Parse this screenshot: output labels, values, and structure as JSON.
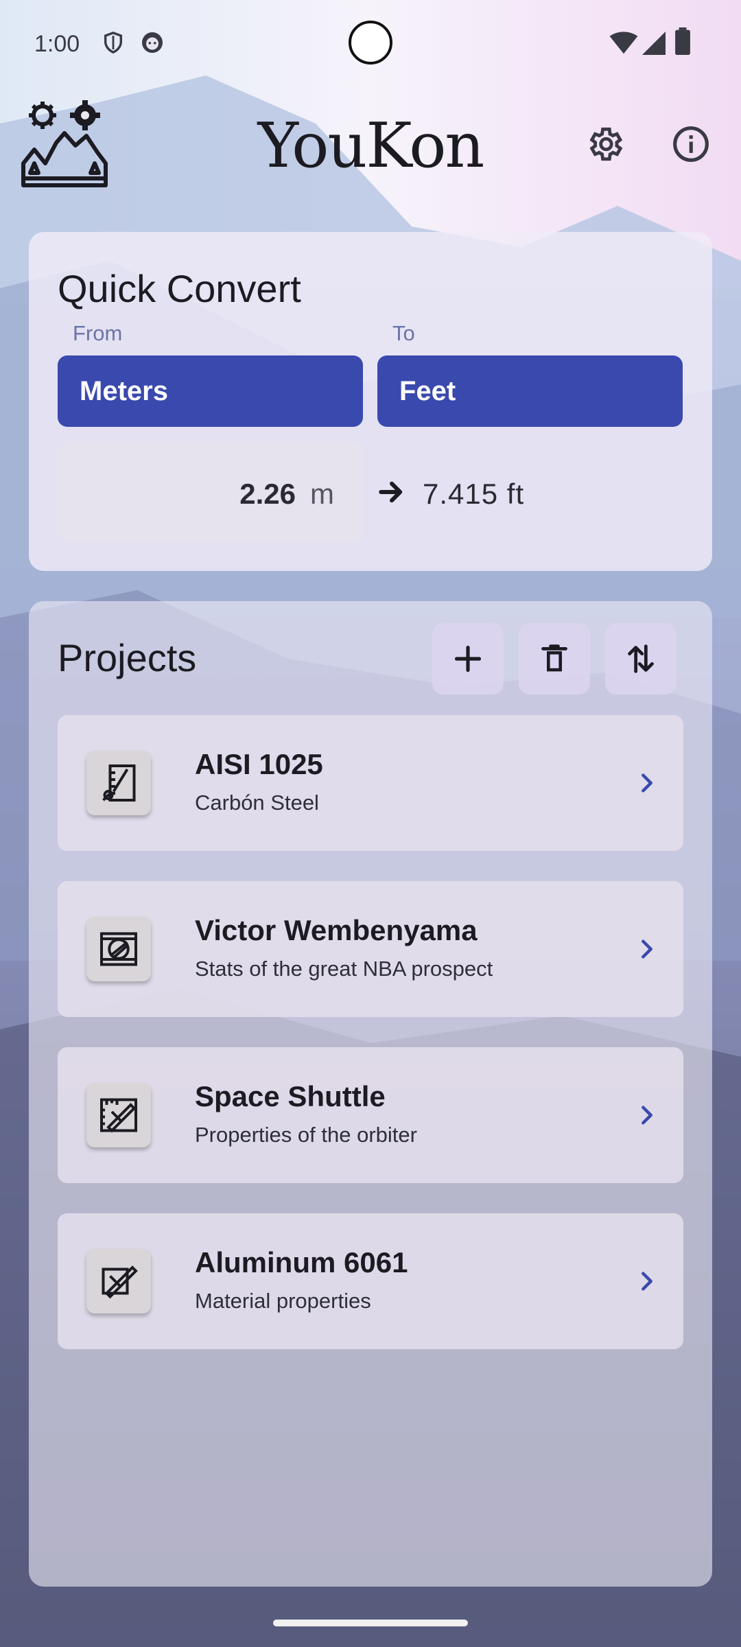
{
  "status_bar": {
    "time": "1:00",
    "icons_left": [
      "shield-icon",
      "face-icon"
    ],
    "icons_right": [
      "wifi-icon",
      "signal-icon",
      "battery-icon"
    ]
  },
  "header": {
    "title": "YouKon",
    "logo_icon": "mountain-gear-logo",
    "settings_icon": "gear-icon",
    "info_icon": "info-icon"
  },
  "quick_convert": {
    "title": "Quick Convert",
    "from_label": "From",
    "to_label": "To",
    "from_unit": "Meters",
    "to_unit": "Feet",
    "input_value": "2.26",
    "input_unit": "m",
    "result": "7.415 ft"
  },
  "projects": {
    "title": "Projects",
    "toolbar_icons": [
      "add-icon",
      "delete-icon",
      "sort-icon"
    ],
    "items": [
      {
        "title": "AISI 1025",
        "subtitle": "Carbón Steel",
        "icon": "ruler-compass-icon"
      },
      {
        "title": "Victor Wembenyama",
        "subtitle": "Stats of the great NBA prospect",
        "icon": "blueprint-circle-icon"
      },
      {
        "title": "Space Shuttle",
        "subtitle": "Properties of the orbiter",
        "icon": "blueprint-pencil-icon"
      },
      {
        "title": "Aluminum 6061",
        "subtitle": "Material properties",
        "icon": "pencil-draw-icon"
      }
    ]
  },
  "colors": {
    "accent": "#3a49ad",
    "chevron": "#3a49ad",
    "label": "#6c74a8"
  }
}
